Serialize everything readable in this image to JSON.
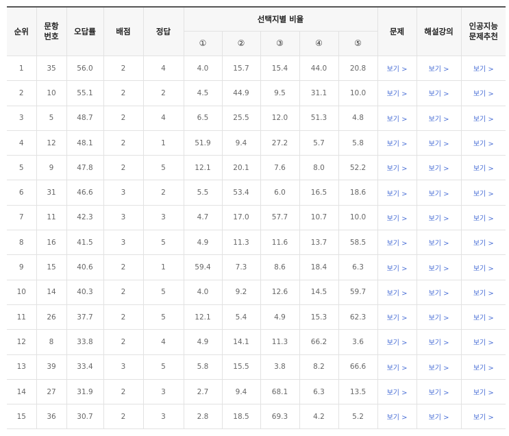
{
  "headers": {
    "rank": "순위",
    "item_no": "문항\n번호",
    "error_rate": "오답률",
    "points": "배점",
    "answer": "정답",
    "choice_ratio": "선택지별 비율",
    "choices": [
      "①",
      "②",
      "③",
      "④",
      "⑤"
    ],
    "problem": "문제",
    "lecture": "해설강의",
    "ai_recommend": "인공지능\n문제추천"
  },
  "link_label": "보기 >",
  "rows": [
    {
      "rank": "1",
      "item": "35",
      "rate": "56.0",
      "points": "2",
      "answer": "4",
      "c": [
        "4.0",
        "15.7",
        "15.4",
        "44.0",
        "20.8"
      ]
    },
    {
      "rank": "2",
      "item": "10",
      "rate": "55.1",
      "points": "2",
      "answer": "2",
      "c": [
        "4.5",
        "44.9",
        "9.5",
        "31.1",
        "10.0"
      ]
    },
    {
      "rank": "3",
      "item": "5",
      "rate": "48.7",
      "points": "2",
      "answer": "4",
      "c": [
        "6.5",
        "25.5",
        "12.0",
        "51.3",
        "4.8"
      ]
    },
    {
      "rank": "4",
      "item": "12",
      "rate": "48.1",
      "points": "2",
      "answer": "1",
      "c": [
        "51.9",
        "9.4",
        "27.2",
        "5.7",
        "5.8"
      ]
    },
    {
      "rank": "5",
      "item": "9",
      "rate": "47.8",
      "points": "2",
      "answer": "5",
      "c": [
        "12.1",
        "20.1",
        "7.6",
        "8.0",
        "52.2"
      ]
    },
    {
      "rank": "6",
      "item": "31",
      "rate": "46.6",
      "points": "3",
      "answer": "2",
      "c": [
        "5.5",
        "53.4",
        "6.0",
        "16.5",
        "18.6"
      ]
    },
    {
      "rank": "7",
      "item": "11",
      "rate": "42.3",
      "points": "3",
      "answer": "3",
      "c": [
        "4.7",
        "17.0",
        "57.7",
        "10.7",
        "10.0"
      ]
    },
    {
      "rank": "8",
      "item": "16",
      "rate": "41.5",
      "points": "3",
      "answer": "5",
      "c": [
        "4.9",
        "11.3",
        "11.6",
        "13.7",
        "58.5"
      ]
    },
    {
      "rank": "9",
      "item": "15",
      "rate": "40.6",
      "points": "2",
      "answer": "1",
      "c": [
        "59.4",
        "7.3",
        "8.6",
        "18.4",
        "6.3"
      ]
    },
    {
      "rank": "10",
      "item": "14",
      "rate": "40.3",
      "points": "2",
      "answer": "5",
      "c": [
        "4.0",
        "9.2",
        "12.6",
        "14.5",
        "59.7"
      ]
    },
    {
      "rank": "11",
      "item": "26",
      "rate": "37.7",
      "points": "2",
      "answer": "5",
      "c": [
        "12.1",
        "5.4",
        "4.9",
        "15.3",
        "62.3"
      ]
    },
    {
      "rank": "12",
      "item": "8",
      "rate": "33.8",
      "points": "2",
      "answer": "4",
      "c": [
        "4.9",
        "14.1",
        "11.3",
        "66.2",
        "3.6"
      ]
    },
    {
      "rank": "13",
      "item": "39",
      "rate": "33.4",
      "points": "3",
      "answer": "5",
      "c": [
        "5.8",
        "15.5",
        "3.8",
        "8.2",
        "66.6"
      ]
    },
    {
      "rank": "14",
      "item": "27",
      "rate": "31.9",
      "points": "2",
      "answer": "3",
      "c": [
        "2.7",
        "9.4",
        "68.1",
        "6.3",
        "13.5"
      ]
    },
    {
      "rank": "15",
      "item": "36",
      "rate": "30.7",
      "points": "2",
      "answer": "3",
      "c": [
        "2.8",
        "18.5",
        "69.3",
        "4.2",
        "5.2"
      ]
    }
  ]
}
